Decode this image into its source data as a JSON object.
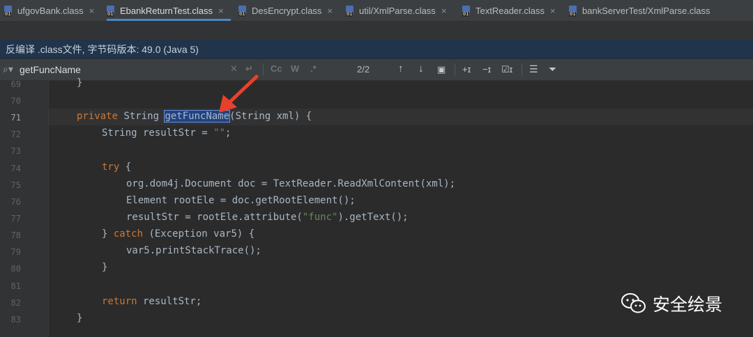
{
  "tabs": [
    {
      "label": "ufgovBank.class",
      "close": "×",
      "active": false
    },
    {
      "label": "EbankReturnTest.class",
      "close": "×",
      "active": true
    },
    {
      "label": "DesEncrypt.class",
      "close": "×",
      "active": false
    },
    {
      "label": "util/XmlParse.class",
      "close": "×",
      "active": false
    },
    {
      "label": "TextReader.class",
      "close": "×",
      "active": false
    },
    {
      "label": "bankServerTest/XmlParse.class",
      "close": "×",
      "active": false
    }
  ],
  "banner": {
    "text": "反编译 .class文件, 字节码版本: 49.0 (Java 5)"
  },
  "search": {
    "query": "getFuncName",
    "match_case": "Cc",
    "whole_words": "W",
    "regex": ".*",
    "count": "2/2"
  },
  "lines": [
    {
      "n": "69",
      "code": "}"
    },
    {
      "n": "70",
      "code": ""
    },
    {
      "n": "71",
      "code": "private String getFuncName(String xml) {"
    },
    {
      "n": "72",
      "code": "String resultStr = \"\";"
    },
    {
      "n": "73",
      "code": ""
    },
    {
      "n": "74",
      "code": "try {"
    },
    {
      "n": "75",
      "code": "org.dom4j.Document doc = TextReader.ReadXmlContent(xml);"
    },
    {
      "n": "76",
      "code": "Element rootEle = doc.getRootElement();"
    },
    {
      "n": "77",
      "code": "resultStr = rootEle.attribute(\"func\").getText();"
    },
    {
      "n": "78",
      "code": "} catch (Exception var5) {"
    },
    {
      "n": "79",
      "code": "var5.printStackTrace();"
    },
    {
      "n": "80",
      "code": "}"
    },
    {
      "n": "81",
      "code": ""
    },
    {
      "n": "82",
      "code": "return resultStr;"
    },
    {
      "n": "83",
      "code": "}"
    }
  ],
  "code_parts": {
    "l71_kw": "private",
    "l71_type": " String ",
    "l71_match": "getFuncName",
    "l71_rest": "(String xml) {",
    "l72_pre": "String resultStr = ",
    "l72_str": "\"\"",
    "l72_post": ";",
    "l74_kw": "try",
    "l74_rest": " {",
    "l77_pre": "resultStr = rootEle.attribute(",
    "l77_str": "\"func\"",
    "l77_post": ").getText();",
    "l78_pre": "} ",
    "l78_kw": "catch",
    "l78_rest": " (Exception var5) {",
    "l82_kw": "return",
    "l82_rest": " resultStr;"
  },
  "watermark": {
    "text": "安全绘景"
  },
  "colors": {
    "accent": "#4a88c7",
    "highlight": "#214283",
    "arrow": "#e8412b",
    "keyword": "#cc7832"
  }
}
